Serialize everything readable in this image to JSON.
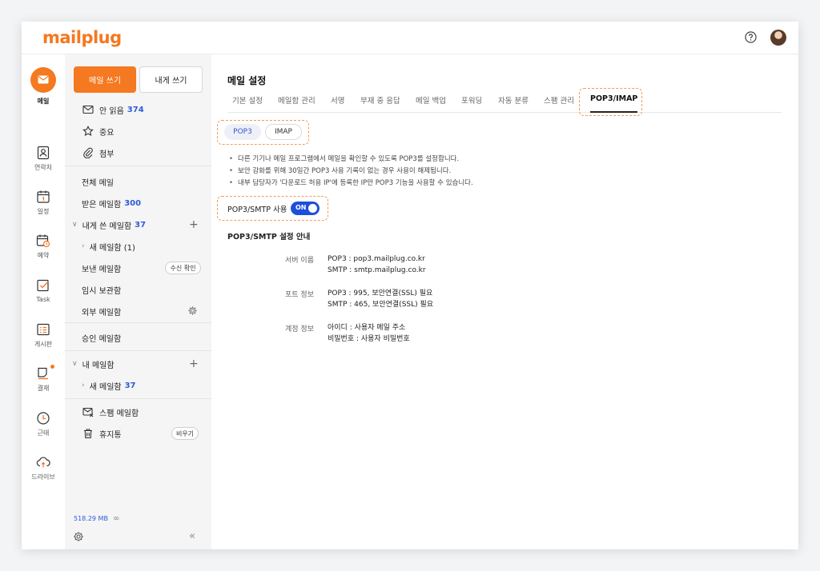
{
  "app": {
    "logo": "mailplug"
  },
  "rail": [
    {
      "label": "메일",
      "icon": "mail-icon"
    },
    {
      "label": "연락처",
      "icon": "contacts-icon"
    },
    {
      "label": "일정",
      "icon": "calendar-icon"
    },
    {
      "label": "예약",
      "icon": "reservation-icon"
    },
    {
      "label": "Task",
      "icon": "task-icon"
    },
    {
      "label": "게시판",
      "icon": "board-icon"
    },
    {
      "label": "결재",
      "icon": "approval-icon"
    },
    {
      "label": "근태",
      "icon": "attendance-icon"
    },
    {
      "label": "드라이브",
      "icon": "drive-icon"
    }
  ],
  "sidebar": {
    "compose": "메일 쓰기",
    "self_compose": "내게 쓰기",
    "unread": {
      "label": "안 읽음",
      "count": "374"
    },
    "important": "중요",
    "attachment": "첨부",
    "all_mail": "전체 메일",
    "inbox": {
      "label": "받은 메일함",
      "count": "300"
    },
    "self_folder": {
      "label": "내게 쓴 메일함",
      "count": "37"
    },
    "self_sub": "새 메일함 (1)",
    "sent": "보낸 메일함",
    "read_check": "수신 확인",
    "drafts": "임시 보관함",
    "external": "외부 메일함",
    "approval": "승인 메일함",
    "my_folders": "내 메일함",
    "my_sub": {
      "label": "새 메일함",
      "count": "37"
    },
    "spam": "스팸 메일함",
    "trash": "휴지통",
    "empty": "비우기",
    "storage": "518.29 MB",
    "storage_limit": "∞",
    "collapse": "«"
  },
  "main": {
    "title": "메일 설정",
    "tabs": [
      "기본 설정",
      "메일함 관리",
      "서명",
      "부재 중 응답",
      "메일 백업",
      "포워딩",
      "자동 분류",
      "스팸 관리",
      "POP3/IMAP"
    ],
    "active_tab": "POP3/IMAP",
    "segments": {
      "pop3": "POP3",
      "imap": "IMAP"
    },
    "bullets": [
      "다른 기기나 메일 프로그램에서 메일을 확인할 수 있도록 POP3를 설정합니다.",
      "보안 강화를 위해 30일간 POP3 사용 기록이 없는 경우 사용이 해제됩니다.",
      "내부 담당자가 '다운로드 허용 IP'에 등록한 IP만 POP3 기능을 사용할 수 있습니다."
    ],
    "toggle_label": "POP3/SMTP 사용",
    "toggle_state": "ON",
    "guide_title": "POP3/SMTP 설정 안내",
    "server": {
      "label": "서버 이름",
      "line1": "POP3 : pop3.mailplug.co.kr",
      "line2": "SMTP : smtp.mailplug.co.kr"
    },
    "port": {
      "label": "포트 정보",
      "line1": "POP3 : 995, 보안연결(SSL) 필요",
      "line2": "SMTP : 465, 보안연결(SSL) 필요"
    },
    "account": {
      "label": "계정 정보",
      "line1": "아이디 : 사용자 메일 주소",
      "line2": "비밀번호 : 사용자 비밀번호"
    }
  },
  "colors": {
    "accent": "#f47920",
    "link": "#2d5bd7",
    "toggle": "#1e4fd8"
  }
}
